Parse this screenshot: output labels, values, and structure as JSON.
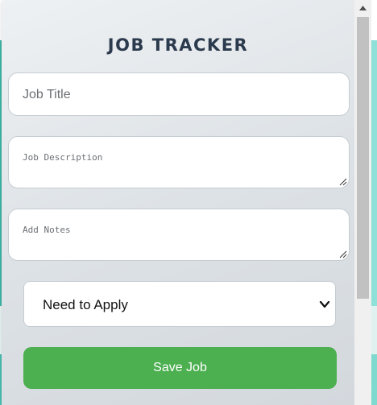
{
  "app": {
    "title": "JOB TRACKER"
  },
  "form": {
    "job_title_placeholder": "Job Title",
    "job_description_placeholder": "Job Description",
    "notes_placeholder": "Add Notes",
    "status_selected": "Need to Apply",
    "save_label": "Save Job"
  },
  "colors": {
    "save_button": "#4caf50",
    "title_text": "#2b3a4d"
  },
  "icons": {
    "select_arrow": "chevron-down-icon",
    "scroll_up": "scroll-up-arrow-icon",
    "resize": "resize-handle-icon"
  }
}
